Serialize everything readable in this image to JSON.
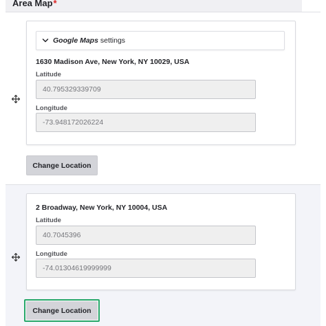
{
  "field": {
    "label": "Area Map",
    "required_marker": "*"
  },
  "settings": {
    "title_em": "Google Maps",
    "title_rest": " settings",
    "expanded": false
  },
  "locations": [
    {
      "address": "1630 Madison Ave, New York, NY 10029, USA",
      "latitude_label": "Latitude",
      "latitude_value": "40.795329339709",
      "longitude_label": "Longitude",
      "longitude_value": "-73.948172026224",
      "change_button": "Change Location"
    },
    {
      "address": "2 Broadway, New York, NY 10004, USA",
      "latitude_label": "Latitude",
      "latitude_value": "40.7045396",
      "longitude_label": "Longitude",
      "longitude_value": "-74.01304619999999",
      "change_button": "Change Location"
    }
  ],
  "colors": {
    "required": "#dc2323",
    "focus_ring": "#26a769",
    "button_bg": "#d3d4d9",
    "row_highlight": "#f3f4f9"
  },
  "icons": {
    "drag_handle": "move-arrows-icon",
    "toggle": "chevron-down-icon"
  }
}
